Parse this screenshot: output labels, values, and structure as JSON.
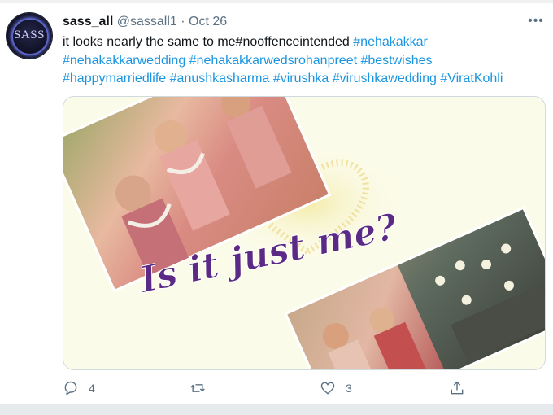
{
  "tweet": {
    "display_name": "sass_all",
    "handle": "@sassall1",
    "separator": "·",
    "date": "Oct 26",
    "more_icon": "more-dots-icon",
    "avatar_text": "SASS",
    "text_plain": "it looks nearly the same to me#nooffenceintended ",
    "hashtags": [
      "#nehakakkar",
      "#nehakakkarwedding",
      "#nehakakkarwedsrohanpreet",
      "#bestwishes",
      "#happymarriedlife",
      "#anushkasharma",
      "#virushka",
      "#virushkawedding",
      "#ViratKohli"
    ],
    "media": {
      "caption": "Is it just me?"
    },
    "actions": {
      "reply_count": "4",
      "retweet_count": "",
      "like_count": "3"
    }
  },
  "colors": {
    "link": "#1b95e0",
    "secondary": "#5b7083",
    "caption": "#5b2a86"
  }
}
